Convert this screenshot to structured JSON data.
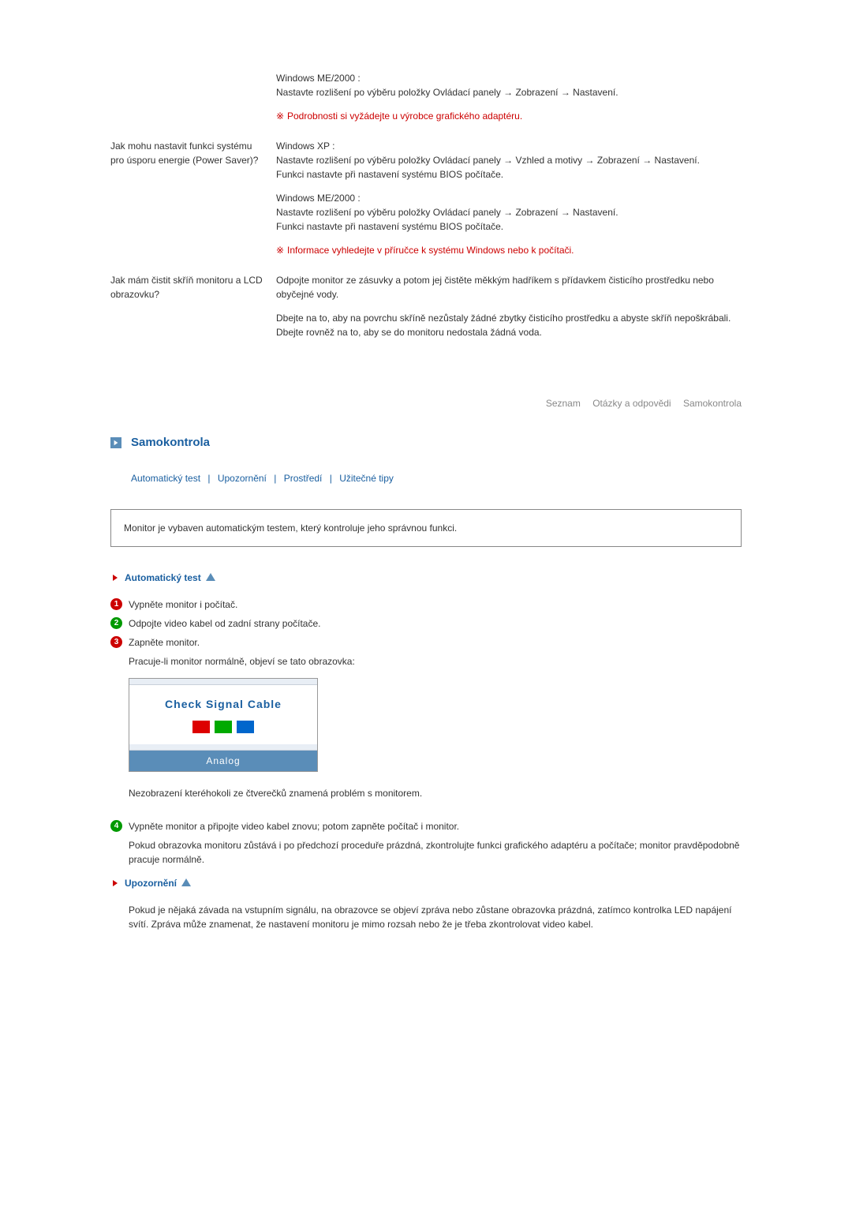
{
  "qa": {
    "q1_answer_a": "Windows ME/2000 :",
    "q1_answer_b": "Nastavte rozlišení po výběru položky Ovládací panely → Zobrazení → Nastavení.",
    "q1_note": "Podrobnosti si vyžádejte u výrobce grafického adaptéru.",
    "q2_question": "Jak mohu nastavit funkci systému pro úsporu energie (Power Saver)?",
    "q2_answer_a": "Windows XP :",
    "q2_answer_b": "Nastavte rozlišení po výběru položky Ovládací panely → Vzhled a motivy → Zobrazení → Nastavení.",
    "q2_answer_c": "Funkci nastavte při nastavení systému BIOS počítače.",
    "q2_answer_d": "Windows ME/2000 :",
    "q2_answer_e": "Nastavte rozlišení po výběru položky Ovládací panely → Zobrazení → Nastavení.",
    "q2_answer_f": "Funkci nastavte při nastavení systému BIOS počítače.",
    "q2_note": "Informace vyhledejte v příručce k systému Windows nebo k počítači.",
    "q3_question": "Jak mám čistit skříň monitoru a LCD obrazovku?",
    "q3_answer_a": "Odpojte monitor ze zásuvky a potom jej čistěte měkkým hadříkem s přídavkem čisticího prostředku nebo obyčejné vody.",
    "q3_answer_b": "Dbejte na to, aby na povrchu skříně nezůstaly žádné zbytky čisticího prostředku a abyste skříň nepoškrábali. Dbejte rovněž na to, aby se do monitoru nedostala žádná voda."
  },
  "nav": {
    "a": "Seznam",
    "b": "Otázky a odpovědi",
    "c": "Samokontrola"
  },
  "section": {
    "title": "Samokontrola",
    "tabs": {
      "a": "Automatický test",
      "b": "Upozornění",
      "c": "Prostředí",
      "d": "Užitečné tipy"
    }
  },
  "info_box": "Monitor je vybaven automatickým testem, který kontroluje jeho správnou funkci.",
  "auto_test": {
    "title": "Automatický test",
    "s1": "Vypněte monitor i počítač.",
    "s2": "Odpojte video kabel od zadní strany počítače.",
    "s3": "Zapněte monitor.",
    "s3b": "Pracuje-li monitor normálně, objeví se tato obrazovka:",
    "signal_title": "Check Signal Cable",
    "signal_mode": "Analog",
    "caption": "Nezobrazení kteréhokoli ze čtverečků znamená problém s monitorem.",
    "s4": "Vypněte monitor a připojte video kabel znovu; potom zapněte počítač i monitor.",
    "s4b": "Pokud obrazovka monitoru zůstává i po předchozí proceduře prázdná, zkontrolujte funkci grafického adaptéru a počítače; monitor pravděpodobně pracuje normálně."
  },
  "warning": {
    "title": "Upozornění",
    "text": "Pokud je nějaká závada na vstupním signálu, na obrazovce se objeví zpráva nebo zůstane obrazovka prázdná, zatímco kontrolka LED napájení svítí. Zpráva může znamenat, že nastavení monitoru je mimo rozsah nebo že je třeba zkontrolovat video kabel."
  }
}
